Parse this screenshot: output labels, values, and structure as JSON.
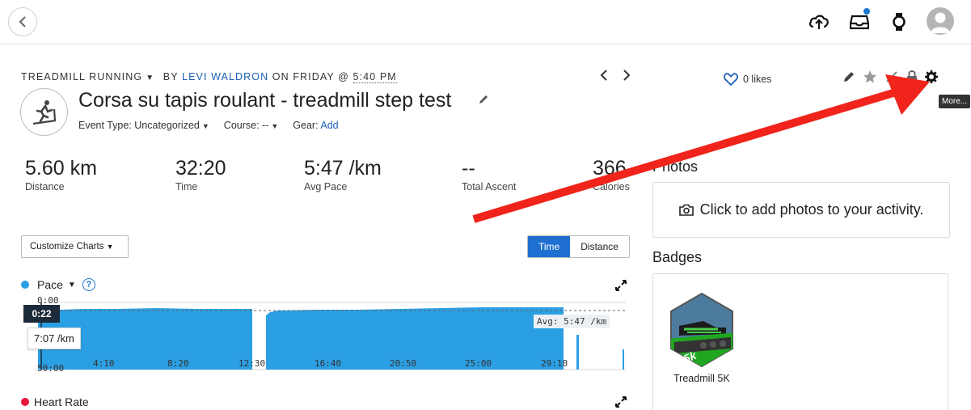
{
  "topbar": {
    "icons": [
      "back-icon",
      "upload-icon",
      "inbox-icon",
      "watch-icon",
      "avatar"
    ]
  },
  "header": {
    "activity_type": "Treadmill Running",
    "by": "BY",
    "author": "LEVI WALDRON",
    "on_day": "ON FRIDAY @",
    "time": "5:40 PM",
    "title": "Corsa su tapis roulant - treadmill step test",
    "event_type_label": "Event Type: Uncategorized",
    "course_label": "Course: --",
    "gear_label": "Gear:",
    "gear_link": "Add"
  },
  "stats": [
    {
      "value": "5.60 km",
      "label": "Distance"
    },
    {
      "value": "32:20",
      "label": "Time"
    },
    {
      "value": "5:47 /km",
      "label": "Avg Pace"
    },
    {
      "value": "--",
      "label": "Total Ascent"
    },
    {
      "value": "366",
      "label": "Calories"
    }
  ],
  "charts": {
    "customize_label": "Customize Charts",
    "toggle": {
      "time": "Time",
      "distance": "Distance",
      "active": "time"
    },
    "pace": {
      "label": "Pace",
      "color": "#2b9fe3",
      "cursor_time": "0:22",
      "cursor_value": "7:07 /km",
      "avg_label": "Avg: 5:47 /km",
      "ytick_top": "0:00",
      "ytick_bottom": "50:00",
      "xticks": [
        "4:10",
        "8:20",
        "12:30",
        "16:40",
        "20:50",
        "25:00",
        "29:10"
      ]
    },
    "heart_rate": {
      "label": "Heart Rate",
      "color": "#e8173d"
    }
  },
  "right": {
    "likes": "0 likes",
    "more_tooltip": "More...",
    "photos_title": "Photos",
    "photos_cta": "Click to add photos to your activity.",
    "badges_title": "Badges",
    "badge_name": "Treadmill 5K",
    "badge_text": "5k"
  },
  "colors": {
    "link": "#1b5fb5",
    "accent": "#1f6fd1",
    "annotation_arrow": "#f0241b"
  }
}
